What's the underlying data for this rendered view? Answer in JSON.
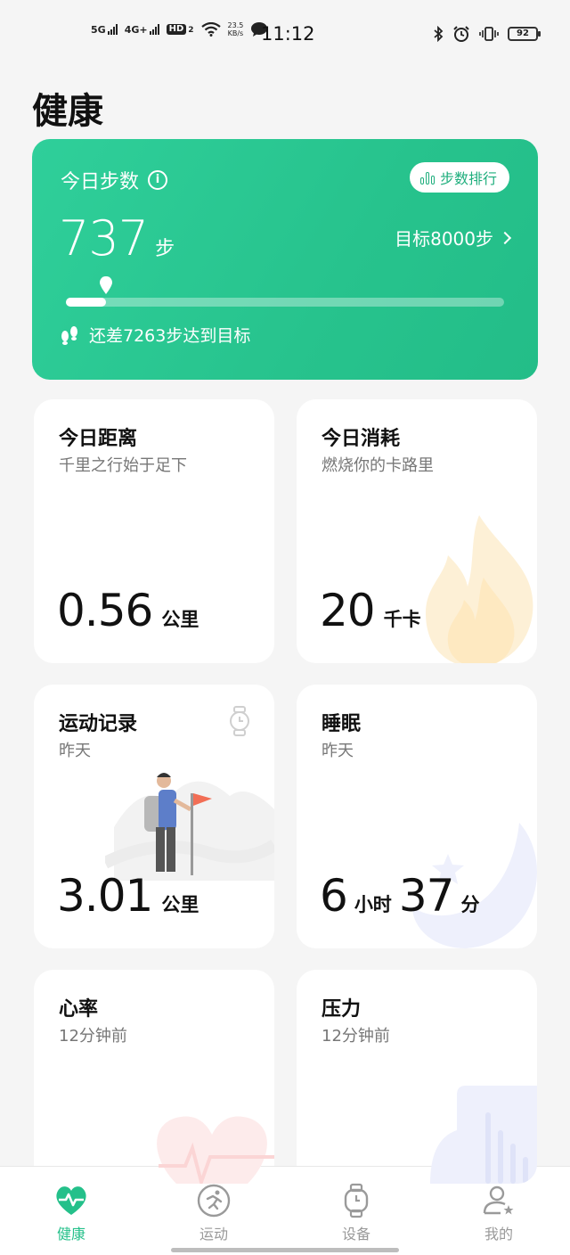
{
  "status_bar": {
    "network1": "5G",
    "network2": "4G+",
    "hd_label": "HD",
    "hd_sub": "2",
    "speed_value": "23.5",
    "speed_unit": "KB/s",
    "time": "11:12",
    "battery": "92"
  },
  "page": {
    "title": "健康"
  },
  "steps_card": {
    "title": "今日步数",
    "rank_button": "步数排行",
    "value": "737",
    "unit": "步",
    "goal_link": "目标8000步",
    "progress_fraction": 0.092,
    "remaining_text": "还差7263步达到目标",
    "accent": "#27c38d"
  },
  "tiles": {
    "distance": {
      "title": "今日距离",
      "subtitle": "千里之行始于足下",
      "value": "0.56",
      "unit": "公里"
    },
    "calories": {
      "title": "今日消耗",
      "subtitle": "燃烧你的卡路里",
      "value": "20",
      "unit": "千卡"
    },
    "workout": {
      "title": "运动记录",
      "subtitle": "昨天",
      "value": "3.01",
      "unit": "公里"
    },
    "sleep": {
      "title": "睡眠",
      "subtitle": "昨天",
      "hours": "6",
      "hours_unit": "小时",
      "minutes": "37",
      "minutes_unit": "分"
    },
    "heart_rate": {
      "title": "心率",
      "subtitle": "12分钟前"
    },
    "stress": {
      "title": "压力",
      "subtitle": "12分钟前"
    }
  },
  "bottom_nav": {
    "items": [
      {
        "label": "健康",
        "icon": "heart-pulse-icon",
        "active": true
      },
      {
        "label": "运动",
        "icon": "running-icon",
        "active": false
      },
      {
        "label": "设备",
        "icon": "watch-icon",
        "active": false
      },
      {
        "label": "我的",
        "icon": "profile-icon",
        "active": false
      }
    ]
  }
}
